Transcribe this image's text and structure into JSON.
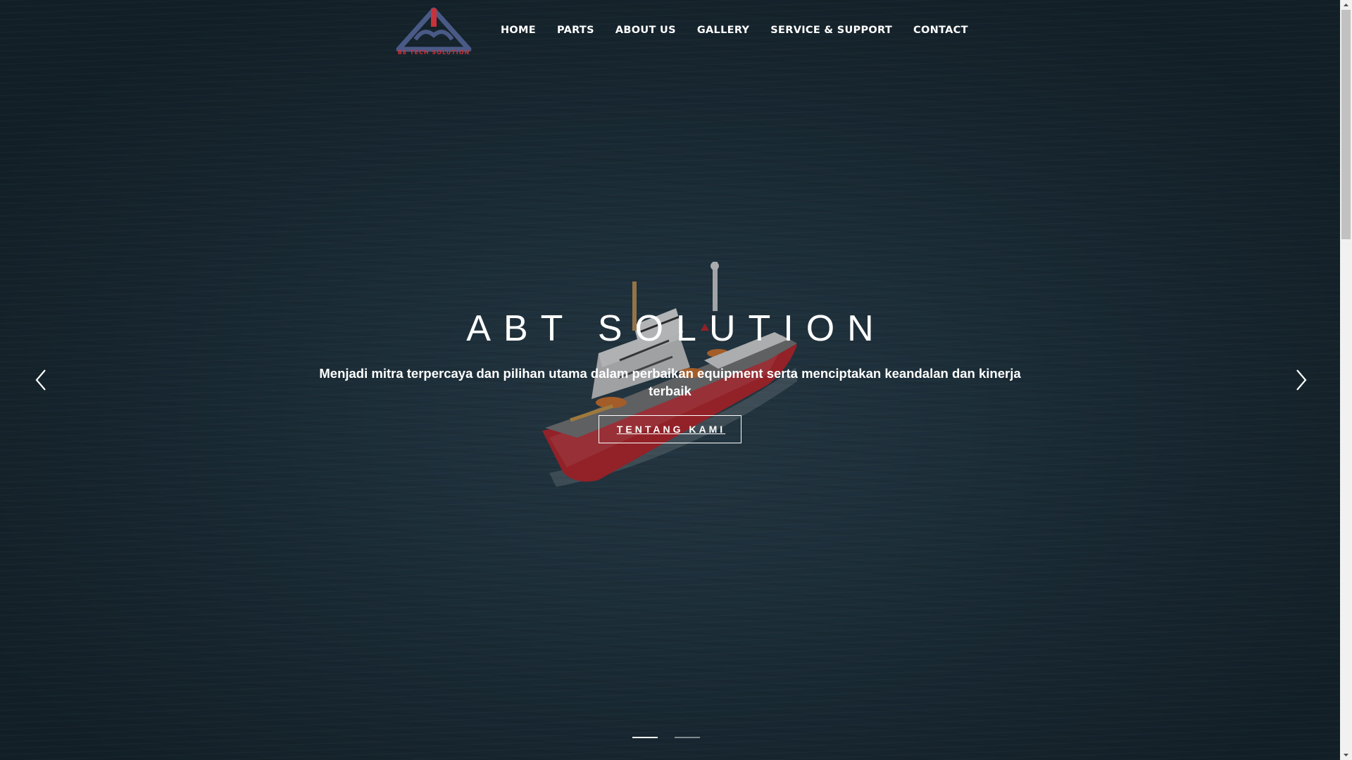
{
  "nav": {
    "logo_text": "BE TECH SOLUTION",
    "items": [
      {
        "label": "HOME"
      },
      {
        "label": "PARTS"
      },
      {
        "label": "ABOUT US"
      },
      {
        "label": "GALLERY"
      },
      {
        "label": "SERVICE & SUPPORT"
      },
      {
        "label": "CONTACT"
      }
    ]
  },
  "hero": {
    "title": "ABT SOLUTION",
    "subtitle": "Menjadi mitra terpercaya dan pilihan utama dalam perbaikan equipment serta menciptakan keandalan dan kinerja terbaik",
    "cta_label": "TENTANG KAMI",
    "slide_count": 2,
    "active_slide": 1
  },
  "icons": {
    "prev": "chevron-left-icon",
    "next": "chevron-right-icon"
  },
  "colors": {
    "logo_blue": "#4a5a86",
    "logo_red": "#c8323a",
    "ship_red": "#c8282e",
    "text": "#ffffff"
  }
}
